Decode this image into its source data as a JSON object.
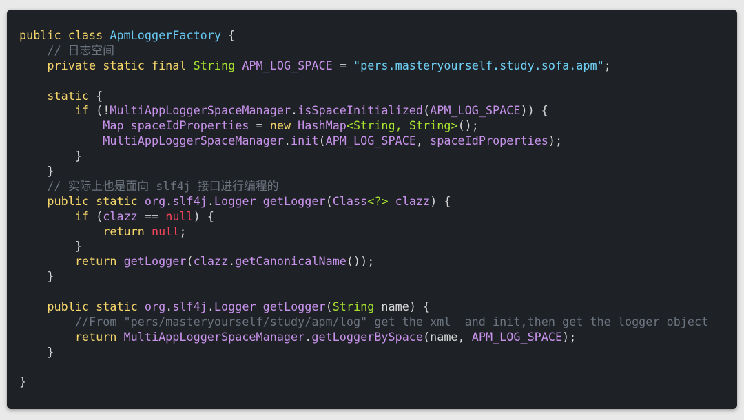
{
  "colors": {
    "background": "#1e2126",
    "page": "#e9e9e9",
    "keyword": "#f4d56a",
    "type": "#a6e22e",
    "class_name": "#67c7f0",
    "string": "#6fd0f4",
    "comment": "#6c7480",
    "identifier": "#c792ea",
    "null": "#f5455c",
    "plain": "#d7d7d7"
  },
  "code": {
    "lines": [
      [
        {
          "t": "public class ",
          "c": "keyword"
        },
        {
          "t": "ApmLoggerFactory",
          "c": "class"
        },
        {
          "t": " {",
          "c": "plain"
        }
      ],
      [
        {
          "t": "    // 日志空间",
          "c": "comment"
        }
      ],
      [
        {
          "t": "    private static final ",
          "c": "keyword"
        },
        {
          "t": "String",
          "c": "type"
        },
        {
          "t": " ",
          "c": "plain"
        },
        {
          "t": "APM_LOG_SPACE",
          "c": "purple"
        },
        {
          "t": " = ",
          "c": "plain"
        },
        {
          "t": "\"pers.masteryourself.study.sofa.apm\"",
          "c": "string"
        },
        {
          "t": ";",
          "c": "plain"
        }
      ],
      [],
      [
        {
          "t": "    static",
          "c": "keyword"
        },
        {
          "t": " {",
          "c": "plain"
        }
      ],
      [
        {
          "t": "        if",
          "c": "keyword"
        },
        {
          "t": " (!",
          "c": "plain"
        },
        {
          "t": "MultiAppLoggerSpaceManager",
          "c": "purple"
        },
        {
          "t": ".",
          "c": "plain"
        },
        {
          "t": "isSpaceInitialized",
          "c": "purple"
        },
        {
          "t": "(",
          "c": "plain"
        },
        {
          "t": "APM_LOG_SPACE",
          "c": "purple"
        },
        {
          "t": ")) {",
          "c": "plain"
        }
      ],
      [
        {
          "t": "            ",
          "c": "plain"
        },
        {
          "t": "Map",
          "c": "purple"
        },
        {
          "t": " ",
          "c": "plain"
        },
        {
          "t": "spaceIdProperties",
          "c": "purple"
        },
        {
          "t": " = ",
          "c": "plain"
        },
        {
          "t": "new",
          "c": "keyword"
        },
        {
          "t": " ",
          "c": "plain"
        },
        {
          "t": "HashMap",
          "c": "purple"
        },
        {
          "t": "<String, String>",
          "c": "type"
        },
        {
          "t": "();",
          "c": "plain"
        }
      ],
      [
        {
          "t": "            ",
          "c": "plain"
        },
        {
          "t": "MultiAppLoggerSpaceManager",
          "c": "purple"
        },
        {
          "t": ".",
          "c": "plain"
        },
        {
          "t": "init",
          "c": "purple"
        },
        {
          "t": "(",
          "c": "plain"
        },
        {
          "t": "APM_LOG_SPACE",
          "c": "purple"
        },
        {
          "t": ", ",
          "c": "plain"
        },
        {
          "t": "spaceIdProperties",
          "c": "purple"
        },
        {
          "t": ");",
          "c": "plain"
        }
      ],
      [
        {
          "t": "        }",
          "c": "plain"
        }
      ],
      [
        {
          "t": "    }",
          "c": "plain"
        }
      ],
      [
        {
          "t": "    // 实际上也是面向 slf4j 接口进行编程的",
          "c": "comment"
        }
      ],
      [
        {
          "t": "    public static ",
          "c": "keyword"
        },
        {
          "t": "org",
          "c": "purple"
        },
        {
          "t": ".",
          "c": "plain"
        },
        {
          "t": "slf4j",
          "c": "purple"
        },
        {
          "t": ".",
          "c": "plain"
        },
        {
          "t": "Logger",
          "c": "purple"
        },
        {
          "t": " ",
          "c": "plain"
        },
        {
          "t": "getLogger",
          "c": "purple"
        },
        {
          "t": "(",
          "c": "plain"
        },
        {
          "t": "Class",
          "c": "purple"
        },
        {
          "t": "<?>",
          "c": "type"
        },
        {
          "t": " ",
          "c": "plain"
        },
        {
          "t": "clazz",
          "c": "purple"
        },
        {
          "t": ") {",
          "c": "plain"
        }
      ],
      [
        {
          "t": "        if",
          "c": "keyword"
        },
        {
          "t": " (",
          "c": "plain"
        },
        {
          "t": "clazz",
          "c": "purple"
        },
        {
          "t": " == ",
          "c": "plain"
        },
        {
          "t": "null",
          "c": "null"
        },
        {
          "t": ") {",
          "c": "plain"
        }
      ],
      [
        {
          "t": "            return",
          "c": "keyword"
        },
        {
          "t": " ",
          "c": "plain"
        },
        {
          "t": "null",
          "c": "null"
        },
        {
          "t": ";",
          "c": "plain"
        }
      ],
      [
        {
          "t": "        }",
          "c": "plain"
        }
      ],
      [
        {
          "t": "        return",
          "c": "keyword"
        },
        {
          "t": " ",
          "c": "plain"
        },
        {
          "t": "getLogger",
          "c": "purple"
        },
        {
          "t": "(",
          "c": "plain"
        },
        {
          "t": "clazz",
          "c": "purple"
        },
        {
          "t": ".",
          "c": "plain"
        },
        {
          "t": "getCanonicalName",
          "c": "purple"
        },
        {
          "t": "());",
          "c": "plain"
        }
      ],
      [
        {
          "t": "    }",
          "c": "plain"
        }
      ],
      [],
      [
        {
          "t": "    public static ",
          "c": "keyword"
        },
        {
          "t": "org",
          "c": "purple"
        },
        {
          "t": ".",
          "c": "plain"
        },
        {
          "t": "slf4j",
          "c": "purple"
        },
        {
          "t": ".",
          "c": "plain"
        },
        {
          "t": "Logger",
          "c": "purple"
        },
        {
          "t": " ",
          "c": "plain"
        },
        {
          "t": "getLogger",
          "c": "purple"
        },
        {
          "t": "(",
          "c": "plain"
        },
        {
          "t": "String",
          "c": "type"
        },
        {
          "t": " name) {",
          "c": "plain"
        }
      ],
      [
        {
          "t": "        //From \"pers/masteryourself/study/apm/log\" get the xml  and init,then get the logger object",
          "c": "comment"
        }
      ],
      [
        {
          "t": "        return",
          "c": "keyword"
        },
        {
          "t": " ",
          "c": "plain"
        },
        {
          "t": "MultiAppLoggerSpaceManager",
          "c": "purple"
        },
        {
          "t": ".",
          "c": "plain"
        },
        {
          "t": "getLoggerBySpace",
          "c": "purple"
        },
        {
          "t": "(name, ",
          "c": "plain"
        },
        {
          "t": "APM_LOG_SPACE",
          "c": "purple"
        },
        {
          "t": ");",
          "c": "plain"
        }
      ],
      [
        {
          "t": "    }",
          "c": "plain"
        }
      ],
      [],
      [
        {
          "t": "}",
          "c": "plain"
        }
      ]
    ]
  }
}
